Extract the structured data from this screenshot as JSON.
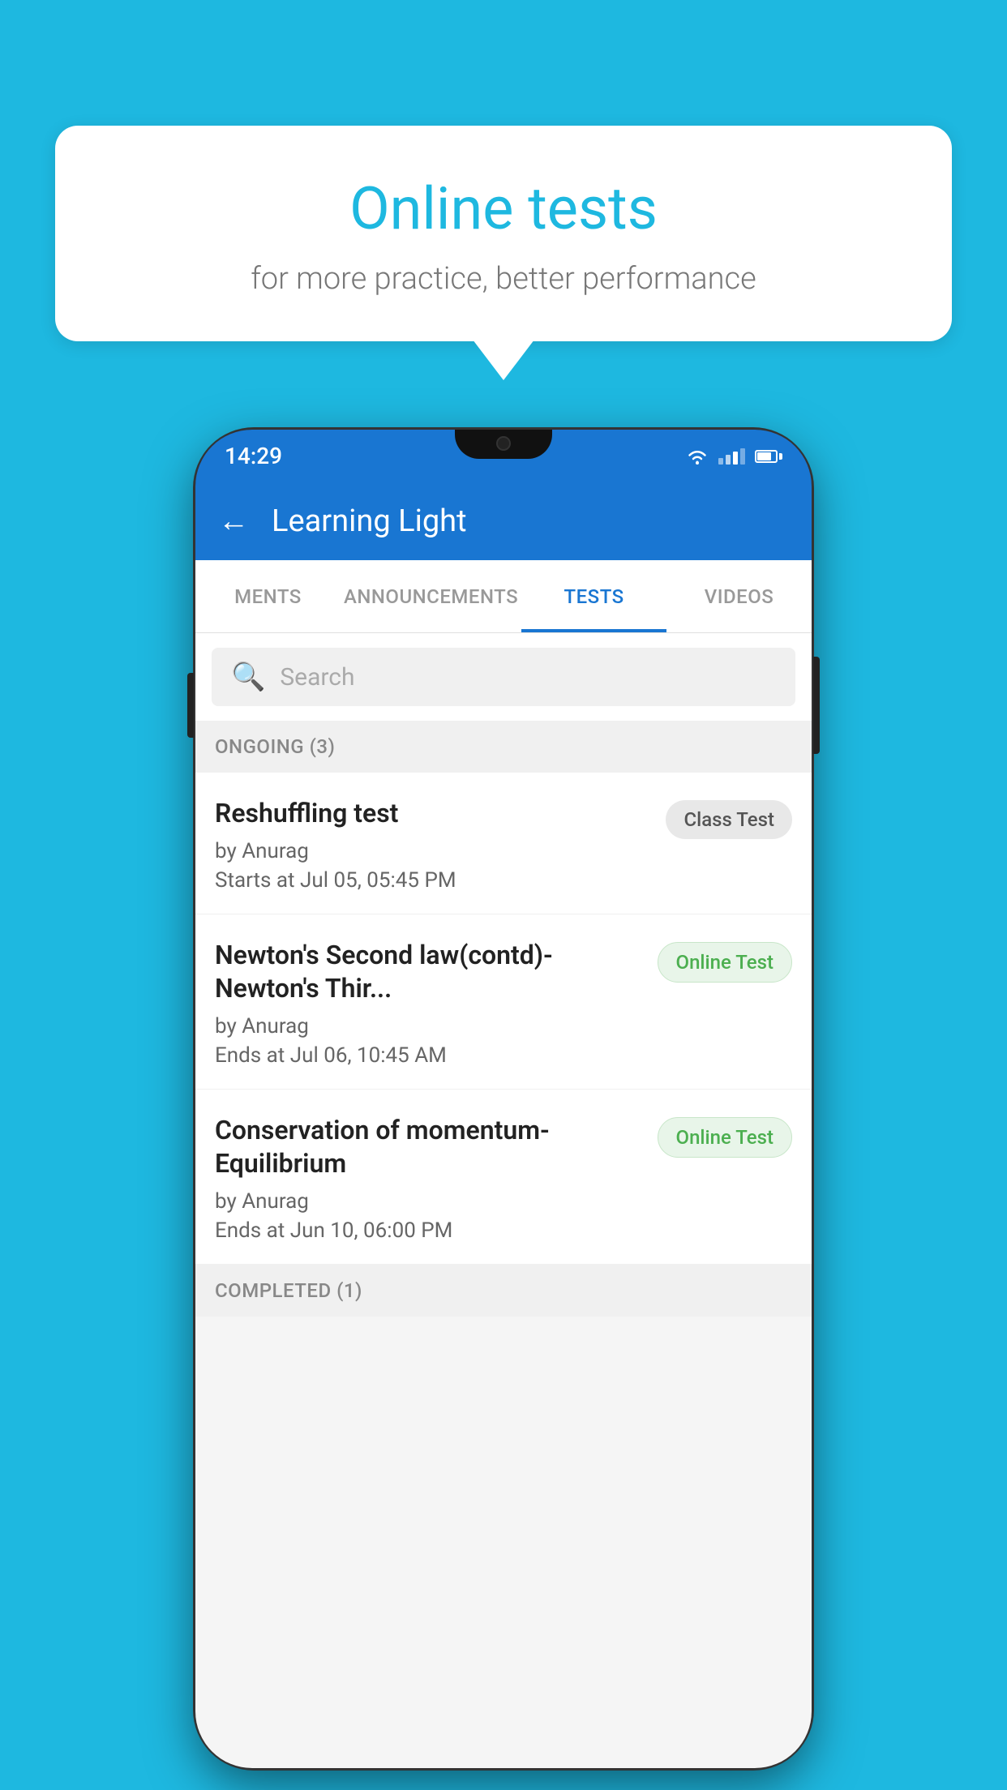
{
  "background_color": "#1eb8e0",
  "bubble": {
    "title": "Online tests",
    "subtitle": "for more practice, better performance"
  },
  "phone": {
    "status_bar": {
      "time": "14:29"
    },
    "app_bar": {
      "title": "Learning Light",
      "back_label": "←"
    },
    "tabs": [
      {
        "label": "MENTS",
        "active": false
      },
      {
        "label": "ANNOUNCEMENTS",
        "active": false
      },
      {
        "label": "TESTS",
        "active": true
      },
      {
        "label": "VIDEOS",
        "active": false
      }
    ],
    "search": {
      "placeholder": "Search"
    },
    "sections": [
      {
        "header": "ONGOING (3)",
        "tests": [
          {
            "name": "Reshuffling test",
            "author": "by Anurag",
            "time_label": "Starts at",
            "time": "Jul 05, 05:45 PM",
            "badge": "Class Test",
            "badge_type": "class"
          },
          {
            "name": "Newton's Second law(contd)-Newton's Thir...",
            "author": "by Anurag",
            "time_label": "Ends at",
            "time": "Jul 06, 10:45 AM",
            "badge": "Online Test",
            "badge_type": "online"
          },
          {
            "name": "Conservation of momentum-Equilibrium",
            "author": "by Anurag",
            "time_label": "Ends at",
            "time": "Jun 10, 06:00 PM",
            "badge": "Online Test",
            "badge_type": "online"
          }
        ]
      }
    ],
    "completed_section": "COMPLETED (1)"
  }
}
